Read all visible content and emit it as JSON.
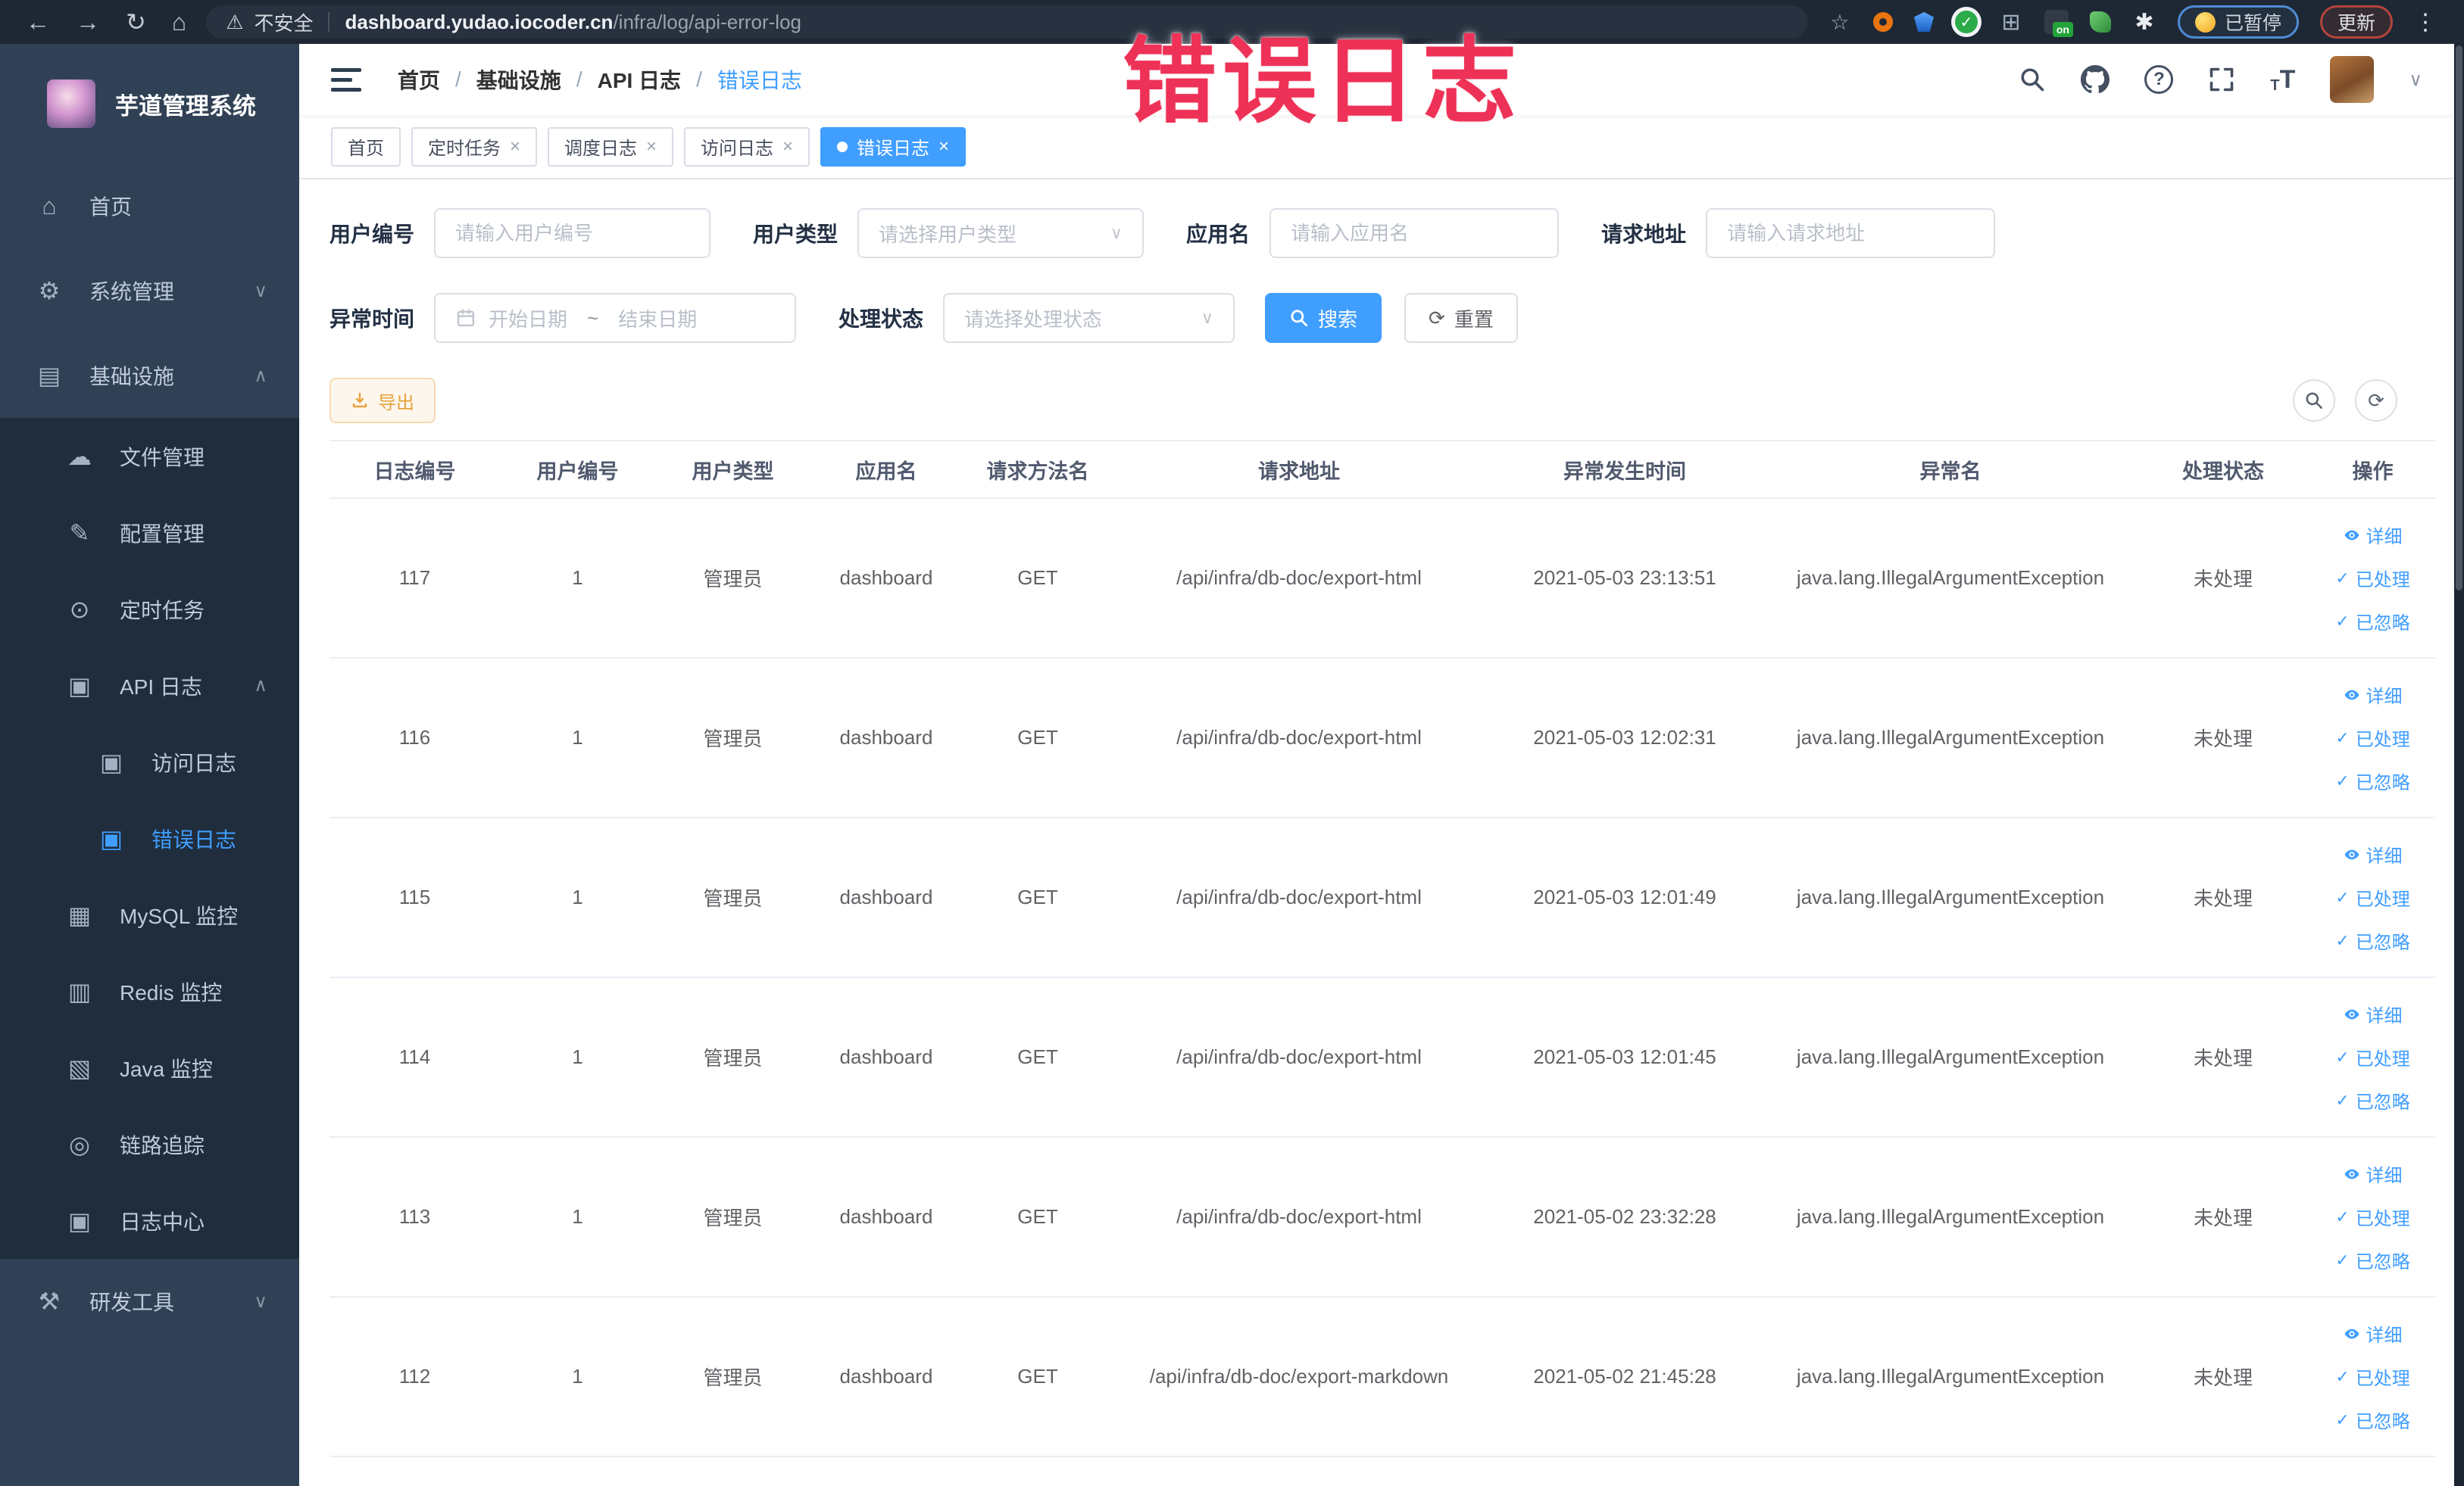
{
  "colors": {
    "accent": "#409eff",
    "warning": "#e6a23c",
    "overlay_red": "#ee3157",
    "sidebar_bg": "#304156",
    "submenu_bg": "#1f2d3d",
    "chrome_bg": "#1e2834"
  },
  "icons": {
    "back": "←",
    "forward": "→",
    "reload": "↻",
    "home": "⌂",
    "star": "☆",
    "warning": "⚠",
    "kebab": "⋮",
    "close": "×",
    "check": "✓",
    "chevron_up": "∧",
    "chevron_down": "∨",
    "caret_down": "∨",
    "refresh": "⟳",
    "grid": "⊞",
    "puzzle": "✱",
    "question": "?",
    "font_big": "T",
    "font_small": "T"
  },
  "browser": {
    "security_label": "不安全",
    "url_host": "dashboard.yudao.iocoder.cn",
    "url_path": "/infra/log/api-error-log",
    "ext_on_label": "on",
    "paused_label": "已暂停",
    "update_label": "更新"
  },
  "overlay": {
    "text": "错误日志"
  },
  "sidebar": {
    "logo_title": "芋道管理系统",
    "top_items": [
      {
        "key": "home",
        "label": "首页",
        "icon": "dashboard",
        "level": 1
      },
      {
        "key": "system",
        "label": "系统管理",
        "icon": "gear",
        "level": 1,
        "chevron": "down"
      },
      {
        "key": "infra",
        "label": "基础设施",
        "icon": "monitor",
        "level": 1,
        "chevron": "up"
      }
    ],
    "sub_items": [
      {
        "key": "file",
        "label": "文件管理",
        "icon": "cloud",
        "level": 2
      },
      {
        "key": "config",
        "label": "配置管理",
        "icon": "edit",
        "level": 2
      },
      {
        "key": "job",
        "label": "定时任务",
        "icon": "clock",
        "level": 2
      },
      {
        "key": "api-log",
        "label": "API 日志",
        "icon": "log",
        "level": 2,
        "chevron": "up"
      },
      {
        "key": "access-log",
        "label": "访问日志",
        "icon": "log",
        "level": 3
      },
      {
        "key": "error-log",
        "label": "错误日志",
        "icon": "log",
        "level": 3,
        "active": true
      },
      {
        "key": "mysql",
        "label": "MySQL 监控",
        "icon": "mysql",
        "level": 2
      },
      {
        "key": "redis",
        "label": "Redis 监控",
        "icon": "redis",
        "level": 2
      },
      {
        "key": "java",
        "label": "Java 监控",
        "icon": "java",
        "level": 2
      },
      {
        "key": "trace",
        "label": "链路追踪",
        "icon": "eye",
        "level": 2
      },
      {
        "key": "log-center",
        "label": "日志中心",
        "icon": "log",
        "level": 2
      }
    ],
    "bottom_items": [
      {
        "key": "dev-tools",
        "label": "研发工具",
        "icon": "tools",
        "level": 1,
        "chevron": "down"
      }
    ]
  },
  "header": {
    "breadcrumb": [
      "首页",
      "基础设施",
      "API 日志",
      "错误日志"
    ],
    "breadcrumb_separator": "/"
  },
  "tabs": [
    {
      "label": "首页",
      "closable": false,
      "active": false
    },
    {
      "label": "定时任务",
      "closable": true,
      "active": false
    },
    {
      "label": "调度日志",
      "closable": true,
      "active": false
    },
    {
      "label": "访问日志",
      "closable": true,
      "active": false
    },
    {
      "label": "错误日志",
      "closable": true,
      "active": true
    }
  ],
  "filters": {
    "user_id_label": "用户编号",
    "user_id_placeholder": "请输入用户编号",
    "user_type_label": "用户类型",
    "user_type_placeholder": "请选择用户类型",
    "app_name_label": "应用名",
    "app_name_placeholder": "请输入应用名",
    "request_url_label": "请求地址",
    "request_url_placeholder": "请输入请求地址",
    "exception_time_label": "异常时间",
    "date_start_placeholder": "开始日期",
    "date_separator": "~",
    "date_end_placeholder": "结束日期",
    "process_status_label": "处理状态",
    "process_status_placeholder": "请选择处理状态",
    "search_label": "搜索",
    "reset_label": "重置"
  },
  "toolbar": {
    "export_label": "导出"
  },
  "table": {
    "columns": [
      "日志编号",
      "用户编号",
      "用户类型",
      "应用名",
      "请求方法名",
      "请求地址",
      "异常发生时间",
      "异常名",
      "处理状态",
      "操作"
    ],
    "row_actions": [
      "详细",
      "已处理",
      "已忽略"
    ],
    "rows": [
      {
        "id": "117",
        "user_id": "1",
        "user_type": "管理员",
        "app": "dashboard",
        "method": "GET",
        "url": "/api/infra/db-doc/export-html",
        "time": "2021-05-03 23:13:51",
        "exception": "java.lang.IllegalArgumentException",
        "status": "未处理"
      },
      {
        "id": "116",
        "user_id": "1",
        "user_type": "管理员",
        "app": "dashboard",
        "method": "GET",
        "url": "/api/infra/db-doc/export-html",
        "time": "2021-05-03 12:02:31",
        "exception": "java.lang.IllegalArgumentException",
        "status": "未处理"
      },
      {
        "id": "115",
        "user_id": "1",
        "user_type": "管理员",
        "app": "dashboard",
        "method": "GET",
        "url": "/api/infra/db-doc/export-html",
        "time": "2021-05-03 12:01:49",
        "exception": "java.lang.IllegalArgumentException",
        "status": "未处理"
      },
      {
        "id": "114",
        "user_id": "1",
        "user_type": "管理员",
        "app": "dashboard",
        "method": "GET",
        "url": "/api/infra/db-doc/export-html",
        "time": "2021-05-03 12:01:45",
        "exception": "java.lang.IllegalArgumentException",
        "status": "未处理"
      },
      {
        "id": "113",
        "user_id": "1",
        "user_type": "管理员",
        "app": "dashboard",
        "method": "GET",
        "url": "/api/infra/db-doc/export-html",
        "time": "2021-05-02 23:32:28",
        "exception": "java.lang.IllegalArgumentException",
        "status": "未处理"
      },
      {
        "id": "112",
        "user_id": "1",
        "user_type": "管理员",
        "app": "dashboard",
        "method": "GET",
        "url": "/api/infra/db-doc/export-markdown",
        "time": "2021-05-02 21:45:28",
        "exception": "java.lang.IllegalArgumentException",
        "status": "未处理"
      }
    ]
  }
}
